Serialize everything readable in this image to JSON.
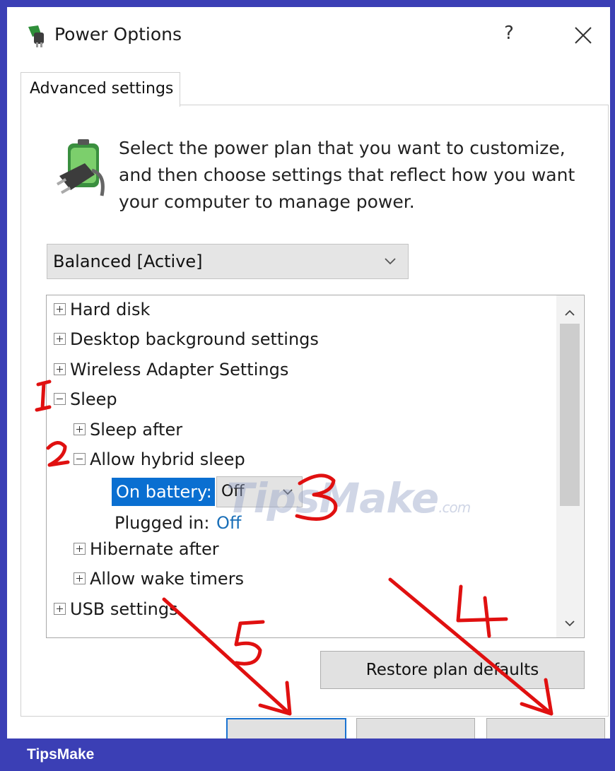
{
  "window": {
    "title": "Power Options",
    "help_label": "?",
    "close_label": "✕",
    "icon": "power-options-icon"
  },
  "tab": {
    "label": "Advanced settings"
  },
  "intro": {
    "icon": "battery-plug-icon",
    "text": "Select the power plan that you want to customize, and then choose settings that reflect how you want your computer to manage power."
  },
  "plan_select": {
    "value": "Balanced [Active]",
    "chevron": "chevron-down-icon"
  },
  "tree": {
    "items": [
      {
        "label": "Hard disk",
        "state": "collapsed"
      },
      {
        "label": "Desktop background settings",
        "state": "collapsed"
      },
      {
        "label": "Wireless Adapter Settings",
        "state": "collapsed"
      },
      {
        "label": "Sleep",
        "state": "expanded"
      },
      {
        "label": "Sleep after",
        "state": "collapsed"
      },
      {
        "label": "Allow hybrid sleep",
        "state": "expanded"
      },
      {
        "label": "Hibernate after",
        "state": "collapsed"
      },
      {
        "label": "Allow wake timers",
        "state": "collapsed"
      },
      {
        "label": "USB settings",
        "state": "collapsed"
      }
    ],
    "on_battery": {
      "label": "On battery:",
      "value": "Off"
    },
    "plugged_in": {
      "label": "Plugged in:",
      "value": "Off"
    }
  },
  "restore_button": {
    "label": "Restore plan defaults"
  },
  "watermark": {
    "text": "TipsMake",
    "suffix": ".com"
  },
  "footer": {
    "brand": "TipsMake"
  },
  "annotations": [
    "1",
    "2",
    "3",
    "4",
    "5"
  ],
  "colors": {
    "frame": "#3b3fb5",
    "selection": "#0a6fd1",
    "link_value": "#1a6fb8",
    "annotation": "#e01010"
  }
}
